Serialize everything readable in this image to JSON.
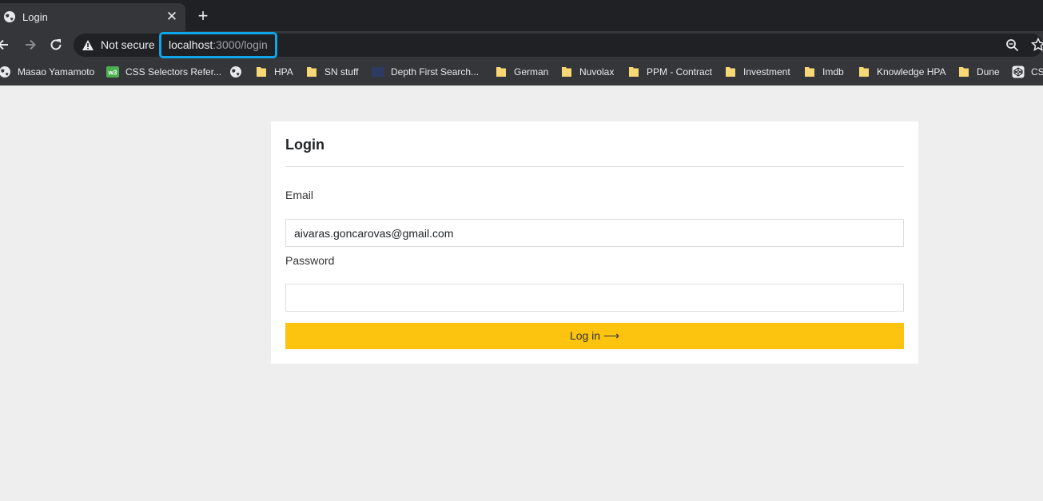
{
  "browser": {
    "tab": {
      "title": "Login",
      "icon": "globe-icon"
    },
    "address_bar": {
      "security_label": "Not secure",
      "url_host": "localhost",
      "url_rest": ":3000/login"
    },
    "bookmarks": [
      {
        "label": "Masao Yamamoto",
        "icon": "globe-icon"
      },
      {
        "label": "CSS Selectors Refer...",
        "icon": "w3-icon"
      },
      {
        "label": "",
        "icon": "globe-icon"
      },
      {
        "label": "HPA",
        "icon": "folder-icon"
      },
      {
        "label": "SN stuff",
        "icon": "folder-icon"
      },
      {
        "label": "Depth First Search...",
        "icon": "bookmark-icon"
      },
      {
        "label": "German",
        "icon": "folder-icon"
      },
      {
        "label": "Nuvolax",
        "icon": "folder-icon"
      },
      {
        "label": "PPM - Contract",
        "icon": "folder-icon"
      },
      {
        "label": "Investment",
        "icon": "folder-icon"
      },
      {
        "label": "Imdb",
        "icon": "folder-icon"
      },
      {
        "label": "Knowledge HPA",
        "icon": "folder-icon"
      },
      {
        "label": "Dune",
        "icon": "folder-icon"
      },
      {
        "label": "CS",
        "icon": "codepen-icon"
      }
    ]
  },
  "login": {
    "title": "Login",
    "email_label": "Email",
    "email_value": "aivaras.goncarovas@gmail.com",
    "password_label": "Password",
    "password_value": "",
    "submit_label": "Log in ⟶"
  },
  "colors": {
    "accent": "#fcc30f",
    "url_highlight": "#0ea5e9",
    "page_background": "#eeeeee",
    "browser_chrome": "#35363a"
  }
}
